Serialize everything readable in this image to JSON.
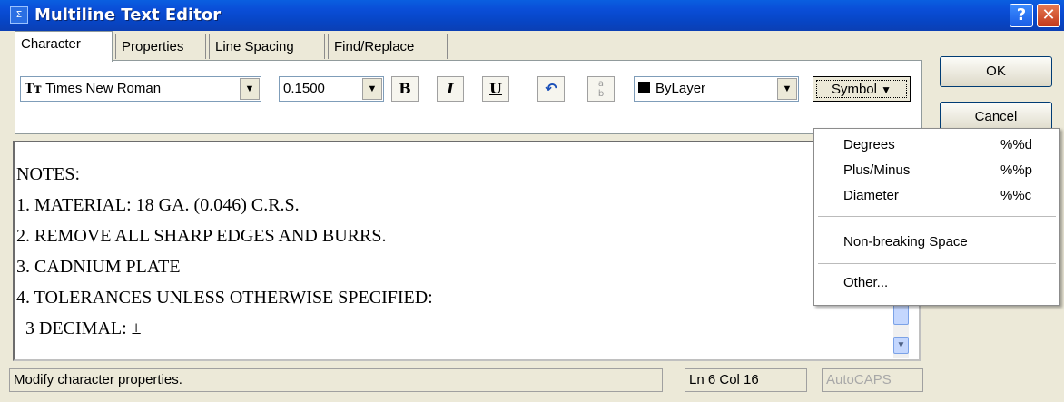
{
  "window": {
    "title": "Multiline Text Editor",
    "icon": "text-editor-icon"
  },
  "tabs": [
    {
      "label": "Character",
      "active": true
    },
    {
      "label": "Properties",
      "active": false
    },
    {
      "label": "Line Spacing",
      "active": false
    },
    {
      "label": "Find/Replace",
      "active": false
    }
  ],
  "toolbar": {
    "font": "Times New Roman",
    "font_type_glyph": "Tт",
    "height": "0.1500",
    "bold": "B",
    "italic": "I",
    "underline": "U",
    "undo_icon": "undo-icon",
    "stack_icon": "stack-fraction-icon",
    "color": "ByLayer",
    "symbol": "Symbol"
  },
  "buttons": {
    "ok": "OK",
    "cancel": "Cancel"
  },
  "editor": {
    "lines": [
      "NOTES:",
      "1. MATERIAL: 18 GA. (0.046) C.R.S.",
      "2. REMOVE ALL SHARP EDGES AND BURRS.",
      "3. CADNIUM PLATE",
      "4. TOLERANCES UNLESS OTHERWISE SPECIFIED:",
      "  3 DECIMAL: ±"
    ]
  },
  "symbol_menu": {
    "items": [
      {
        "label": "Degrees",
        "code": "%%d"
      },
      {
        "label": "Plus/Minus",
        "code": "%%p"
      },
      {
        "label": "Diameter",
        "code": "%%c"
      },
      {
        "label": "Non-breaking Space",
        "code": ""
      },
      {
        "label": "Other...",
        "code": ""
      }
    ]
  },
  "status": {
    "message": "Modify character properties.",
    "position": "Ln 6 Col 16",
    "caps": "AutoCAPS"
  },
  "colors": {
    "titlebar": "#0a4ed8",
    "dialog_bg": "#ece9d8",
    "close": "#c2381a"
  }
}
